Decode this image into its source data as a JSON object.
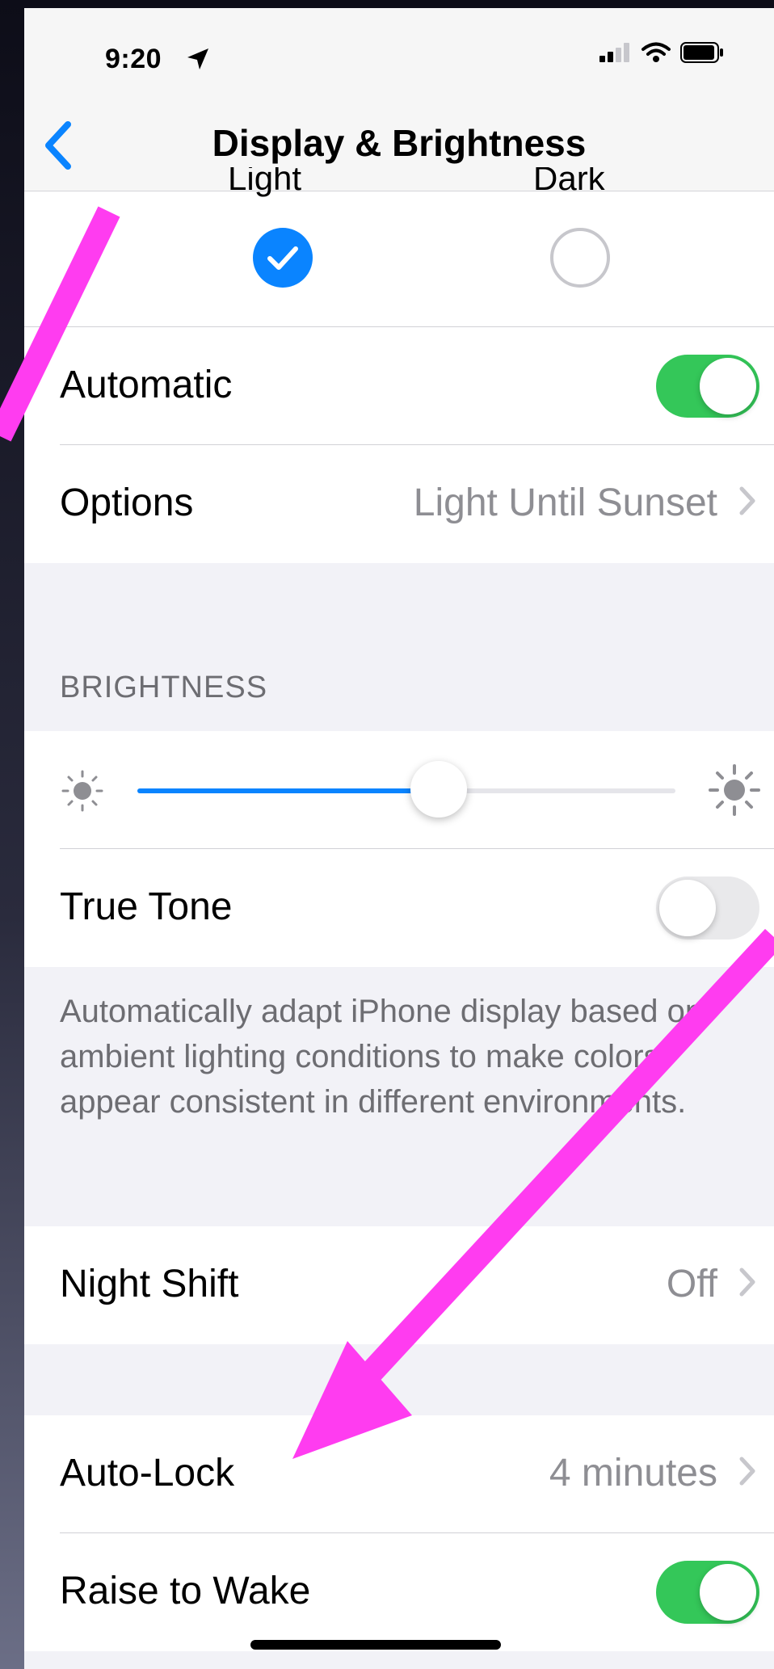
{
  "status_bar": {
    "time": "9:20",
    "icons": [
      "location-arrow-icon",
      "signal-icon",
      "wifi-icon",
      "battery-icon"
    ]
  },
  "nav": {
    "back_icon": "chevron-left-icon",
    "title": "Display & Brightness"
  },
  "appearance": {
    "light_label": "Light",
    "dark_label": "Dark",
    "selected": "light"
  },
  "automatic": {
    "label": "Automatic",
    "on": true
  },
  "options": {
    "label": "Options",
    "value": "Light Until Sunset"
  },
  "brightness": {
    "header": "BRIGHTNESS",
    "level": 0.56,
    "low_icon": "sun-low-icon",
    "high_icon": "sun-high-icon"
  },
  "true_tone": {
    "label": "True Tone",
    "on": false,
    "footer": "Automatically adapt iPhone display based on ambient lighting conditions to make colors appear consistent in different environments."
  },
  "night_shift": {
    "label": "Night Shift",
    "value": "Off"
  },
  "auto_lock": {
    "label": "Auto-Lock",
    "value": "4 minutes"
  },
  "raise_to_wake": {
    "label": "Raise to Wake",
    "on": true
  },
  "colors": {
    "accent_blue": "#0a84ff",
    "toggle_green": "#34c759",
    "annotation_arrow": "#ff3cf0"
  }
}
